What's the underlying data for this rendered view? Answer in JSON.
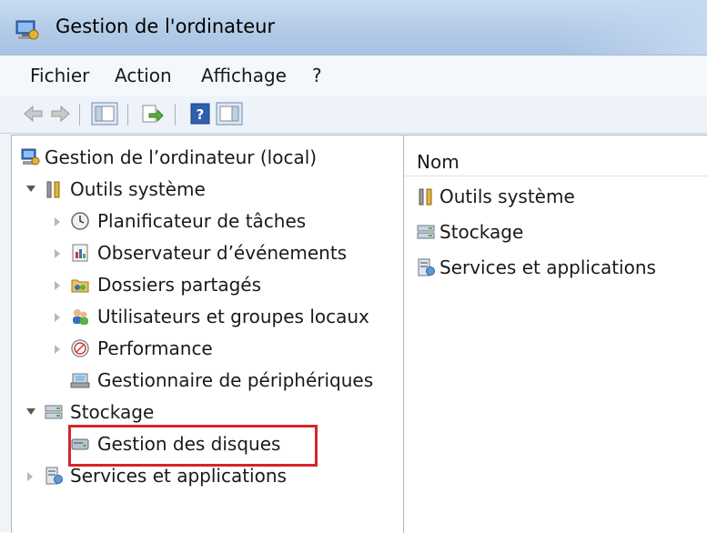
{
  "window": {
    "title": "Gestion de l'ordinateur",
    "icon": "computer-management-icon"
  },
  "menubar": {
    "items": [
      "Fichier",
      "Action",
      "Affichage",
      "?"
    ]
  },
  "toolbar": {
    "buttons": [
      "back-arrow-icon",
      "forward-arrow-icon",
      "show-hide-console-tree-icon",
      "export-list-icon",
      "help-icon",
      "show-hide-action-pane-icon"
    ]
  },
  "tree": {
    "root": {
      "label": "Gestion de l’ordinateur (local)",
      "icon": "computer-management-icon"
    },
    "outils": {
      "label": "Outils système",
      "icon": "tools-icon",
      "expanded": true
    },
    "planificateur": {
      "label": "Planificateur de tâches",
      "icon": "clock-icon"
    },
    "observateur": {
      "label": "Observateur d’événements",
      "icon": "event-viewer-icon"
    },
    "dossiers": {
      "label": "Dossiers partagés",
      "icon": "shared-folder-icon"
    },
    "utilisateurs": {
      "label": "Utilisateurs et groupes locaux",
      "icon": "users-icon"
    },
    "performance": {
      "label": "Performance",
      "icon": "performance-icon"
    },
    "gestionnaire": {
      "label": "Gestionnaire de périphériques",
      "icon": "device-manager-icon"
    },
    "stockage": {
      "label": "Stockage",
      "icon": "storage-icon",
      "expanded": true
    },
    "disques": {
      "label": "Gestion des disques",
      "icon": "disk-icon",
      "highlighted": true
    },
    "services": {
      "label": "Services et applications",
      "icon": "services-icon"
    }
  },
  "list": {
    "header": "Nom",
    "items": [
      {
        "label": "Outils système",
        "icon": "tools-icon"
      },
      {
        "label": "Stockage",
        "icon": "storage-icon"
      },
      {
        "label": "Services et applications",
        "icon": "services-icon"
      }
    ]
  },
  "colors": {
    "highlight": "#d6252b",
    "titlebar": "#b3cbe7"
  }
}
